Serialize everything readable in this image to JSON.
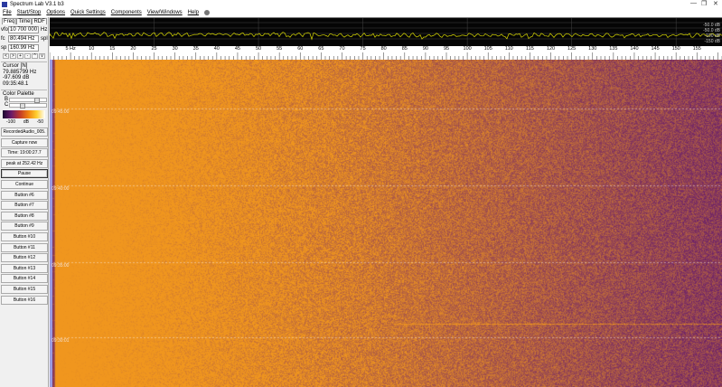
{
  "window": {
    "title": "Spectrum Lab V3.1 b3",
    "controls": [
      "—",
      "❐",
      "✕"
    ]
  },
  "menu": [
    "File",
    "Start/Stop",
    "Options",
    "Quick Settings",
    "Components",
    "View/Windows",
    "Help"
  ],
  "left": {
    "tabs": [
      "Freq",
      "Time",
      "RDF"
    ],
    "fields": [
      {
        "label": "vfo",
        "value": "10 700 000",
        "unit": "Hz"
      },
      {
        "label": "fc",
        "value": "80.494 Hz",
        "unit": "spl"
      },
      {
        "label": "sp",
        "value": "160.99 Hz",
        "unit": ""
      }
    ],
    "arrows": [
      "<",
      ">",
      "+",
      "-",
      "^",
      "v"
    ],
    "cursor": {
      "title": "Cursor [N]",
      "freq": "79.885799 Hz",
      "level": "-97.609 dB",
      "time": "09:35:48.1"
    },
    "palette": {
      "title": "Color Palette",
      "b_label": "B",
      "c_label": "C",
      "b_level": 0.75,
      "c_level": 0.3,
      "axis": [
        "-100",
        "dB",
        "-50"
      ]
    },
    "buttons": [
      "RecordedAudio_005.",
      "Capture now",
      "Time:  19:00:27.7",
      "peak at 252.42 Hz",
      "Pause",
      "Continue",
      "Button #6",
      "Button #7",
      "Button #8",
      "Button #9",
      "Button #10",
      "Button #11",
      "Button #12",
      "Button #13",
      "Button #14",
      "Button #15",
      "Button #16"
    ]
  },
  "spectrum": {
    "db_labels": [
      "-50.0 dB",
      "-50.0 dB",
      "-100 dB",
      "-150 dB"
    ],
    "trace_color": "#d8d800"
  },
  "freq_axis": {
    "labels": [
      "5 Hz",
      "10",
      "15",
      "20",
      "25",
      "30",
      "35",
      "40",
      "45",
      "50",
      "55",
      "60",
      "65",
      "70",
      "75",
      "80",
      "85",
      "90",
      "95",
      "100",
      "105",
      "110",
      "115",
      "120",
      "125",
      "130",
      "135",
      "140",
      "145",
      "150",
      "155"
    ],
    "max_hz": 161
  },
  "waterfall": {
    "time_labels": [
      "09:45:00",
      "09:40:00",
      "09:35:00",
      "09:30:01"
    ],
    "colors": {
      "hot": "#f09020",
      "mid": "#c05040",
      "cool": "#6a2068"
    }
  }
}
